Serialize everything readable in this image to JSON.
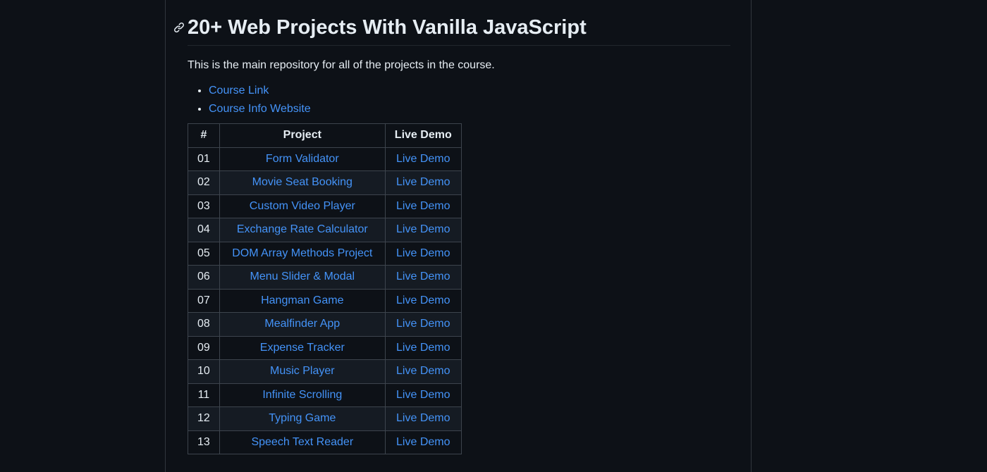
{
  "readme": {
    "title": "20+ Web Projects With Vanilla JavaScript",
    "anchor_icon": "link-icon",
    "intro": "This is the main repository for all of the projects in the course.",
    "links": [
      {
        "label": "Course Link"
      },
      {
        "label": "Course Info Website"
      }
    ],
    "table": {
      "headers": [
        "#",
        "Project",
        "Live Demo"
      ],
      "rows": [
        {
          "num": "01",
          "project": "Form Validator",
          "demo": "Live Demo"
        },
        {
          "num": "02",
          "project": "Movie Seat Booking",
          "demo": "Live Demo"
        },
        {
          "num": "03",
          "project": "Custom Video Player",
          "demo": "Live Demo"
        },
        {
          "num": "04",
          "project": "Exchange Rate Calculator",
          "demo": "Live Demo"
        },
        {
          "num": "05",
          "project": "DOM Array Methods Project",
          "demo": "Live Demo"
        },
        {
          "num": "06",
          "project": "Menu Slider & Modal",
          "demo": "Live Demo"
        },
        {
          "num": "07",
          "project": "Hangman Game",
          "demo": "Live Demo"
        },
        {
          "num": "08",
          "project": "Mealfinder App",
          "demo": "Live Demo"
        },
        {
          "num": "09",
          "project": "Expense Tracker",
          "demo": "Live Demo"
        },
        {
          "num": "10",
          "project": "Music Player",
          "demo": "Live Demo"
        },
        {
          "num": "11",
          "project": "Infinite Scrolling",
          "demo": "Live Demo"
        },
        {
          "num": "12",
          "project": "Typing Game",
          "demo": "Live Demo"
        },
        {
          "num": "13",
          "project": "Speech Text Reader",
          "demo": "Live Demo"
        }
      ]
    }
  },
  "colors": {
    "background": "#0d1117",
    "text": "#e6edf3",
    "link": "#4493f8",
    "border": "#3d444d"
  }
}
